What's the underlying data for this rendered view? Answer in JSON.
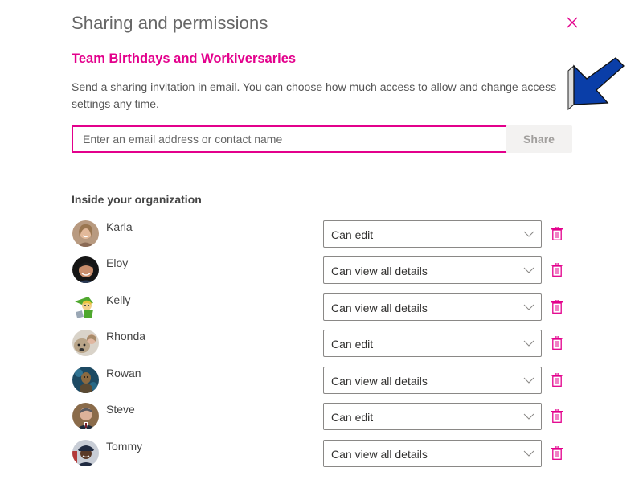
{
  "panel": {
    "title": "Sharing and permissions",
    "close_icon": "close-icon",
    "subtitle": "Team Birthdays and Workiversaries",
    "description": "Send a sharing invitation in email. You can choose how much access to allow and change access settings any time.",
    "email_input": {
      "value": "",
      "placeholder": "Enter an email address or contact name"
    },
    "share_label": "Share",
    "section_label": "Inside your organization"
  },
  "people": [
    {
      "name": "Karla",
      "permission": "Can edit"
    },
    {
      "name": "Eloy",
      "permission": "Can view all details"
    },
    {
      "name": "Kelly",
      "permission": "Can view all details"
    },
    {
      "name": "Rhonda",
      "permission": "Can edit"
    },
    {
      "name": "Rowan",
      "permission": "Can view all details"
    },
    {
      "name": "Steve",
      "permission": "Can edit"
    },
    {
      "name": "Tommy",
      "permission": "Can view all details"
    }
  ],
  "annotation": {
    "icon": "arrow-pointer-icon",
    "color": "#0a3ea8"
  },
  "colors": {
    "accent": "#e3008c",
    "share_bg": "#f3f2f1"
  }
}
